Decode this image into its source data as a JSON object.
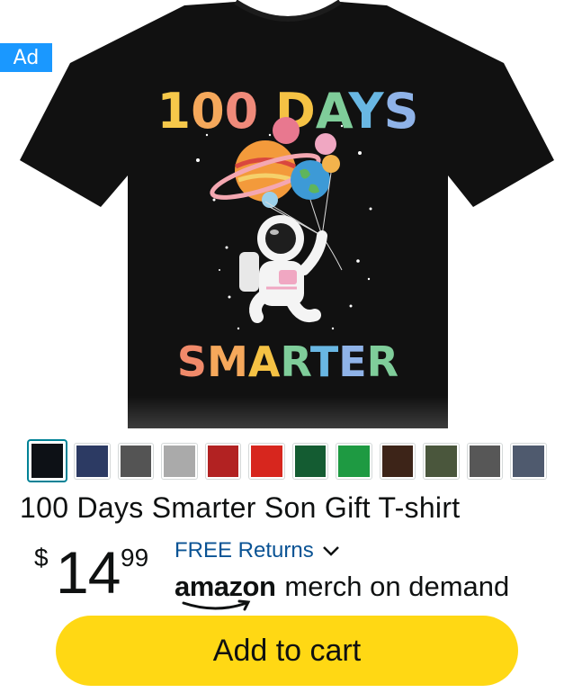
{
  "ad_badge": "Ad",
  "product": {
    "title": "100 Days Smarter Son Gift T-shirt",
    "image_text_top": "100 DAYS",
    "image_text_bottom": "SMARTER",
    "shirt_color": "#111111"
  },
  "swatches": [
    {
      "name": "black",
      "color": "#0d1116",
      "selected": true
    },
    {
      "name": "navy",
      "color": "#2c3a63"
    },
    {
      "name": "dark-heather",
      "color": "#545454"
    },
    {
      "name": "silver",
      "color": "#aaaaaa"
    },
    {
      "name": "cranberry",
      "color": "#b22222"
    },
    {
      "name": "red",
      "color": "#d7261e"
    },
    {
      "name": "kelly-green",
      "color": "#145c32"
    },
    {
      "name": "green",
      "color": "#1e9a42"
    },
    {
      "name": "brown",
      "color": "#3d2418"
    },
    {
      "name": "olive",
      "color": "#4a563c"
    },
    {
      "name": "heather-grey",
      "color": "#575757"
    },
    {
      "name": "slate",
      "color": "#4f5a6e"
    }
  ],
  "price": {
    "symbol": "$",
    "whole": "14",
    "fraction": "99"
  },
  "returns_label": "FREE Returns",
  "brand": {
    "amazon": "amazon",
    "suffix": "merch on demand"
  },
  "add_to_cart_label": "Add to cart",
  "colors": {
    "button": "#ffd814",
    "link": "#0a5394",
    "ad_badge": "#1a98ff"
  }
}
